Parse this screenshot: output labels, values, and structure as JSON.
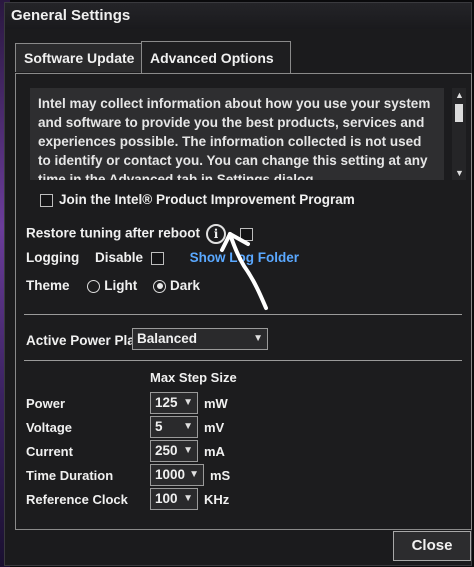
{
  "window": {
    "title": "General Settings"
  },
  "tabs": [
    {
      "label": "Software Update",
      "active": false
    },
    {
      "label": "Advanced Options",
      "active": true
    }
  ],
  "privacy": {
    "text": "Intel may collect information about how you use your system and software to provide you the best products, services and experiences possible. The information collected is not used to identify or contact you. You can change this setting at any time in the Advanced tab in Settings dialog.",
    "checkbox_label": "Join the Intel® Product Improvement Program",
    "checked": false
  },
  "restore": {
    "label": "Restore tuning after reboot",
    "info_glyph": "i",
    "checked": false
  },
  "logging": {
    "label": "Logging",
    "disable_label": "Disable",
    "disabled_checked": false,
    "show_log_label": "Show Log Folder"
  },
  "theme": {
    "label": "Theme",
    "options": [
      "Light",
      "Dark"
    ],
    "selected": "Dark"
  },
  "power_plan": {
    "label": "Active Power Plan",
    "value": "Balanced"
  },
  "step_size": {
    "header": "Max Step Size",
    "rows": [
      {
        "label": "Power",
        "value": "125",
        "unit": "mW"
      },
      {
        "label": "Voltage",
        "value": "5",
        "unit": "mV"
      },
      {
        "label": "Current",
        "value": "250",
        "unit": "mA"
      },
      {
        "label": "Time Duration",
        "value": "1000",
        "unit": "mS"
      },
      {
        "label": "Reference Clock",
        "value": "100",
        "unit": "KHz"
      }
    ]
  },
  "close_label": "Close",
  "icons": {
    "dropdown": "chevron-down-icon",
    "info": "info-icon",
    "scroll_up": "scroll-up-icon",
    "scroll_down": "scroll-down-icon"
  },
  "colors": {
    "link": "#5aa8ff",
    "background": "#1c1c1e",
    "text": "#f0f0f0"
  }
}
